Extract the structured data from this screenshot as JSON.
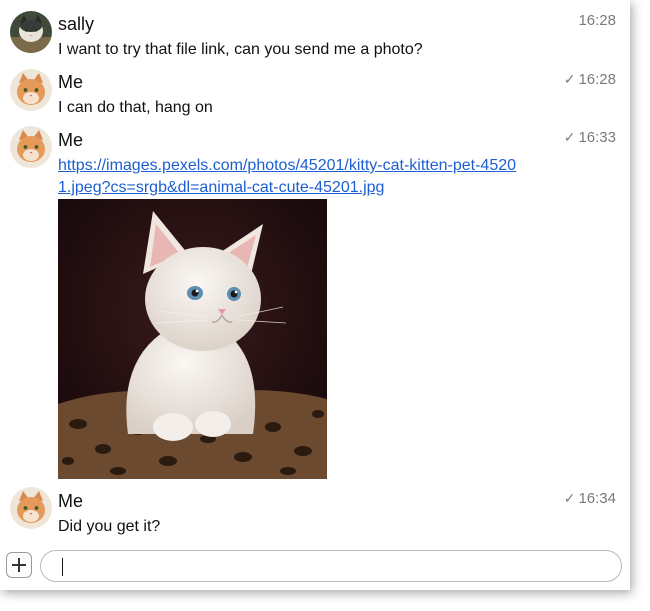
{
  "messages": [
    {
      "sender": "sally",
      "avatar_icon": "cat-avatar-icon",
      "text": "I want to try that file link, can you send me a photo?",
      "time": "16:28",
      "delivered": false
    },
    {
      "sender": "Me",
      "avatar_icon": "cat-avatar-icon",
      "text": "I can do that, hang on",
      "time": "16:28",
      "delivered": true
    },
    {
      "sender": "Me",
      "avatar_icon": "cat-avatar-icon",
      "link": "https://images.pexels.com/photos/45201/kitty-cat-kitten-pet-45201.jpeg?cs=srgb&dl=animal-cat-cute-45201.jpg",
      "attachment": "kitten-photo",
      "time": "16:33",
      "delivered": true
    },
    {
      "sender": "Me",
      "avatar_icon": "cat-avatar-icon",
      "text": "Did you get it?",
      "time": "16:34",
      "delivered": true
    }
  ],
  "check_mark": "✓",
  "composer": {
    "add_icon": "plus-icon",
    "value": "",
    "placeholder": ""
  },
  "colors": {
    "link": "#1d5fd1",
    "timestamp": "#7a7a7a"
  }
}
